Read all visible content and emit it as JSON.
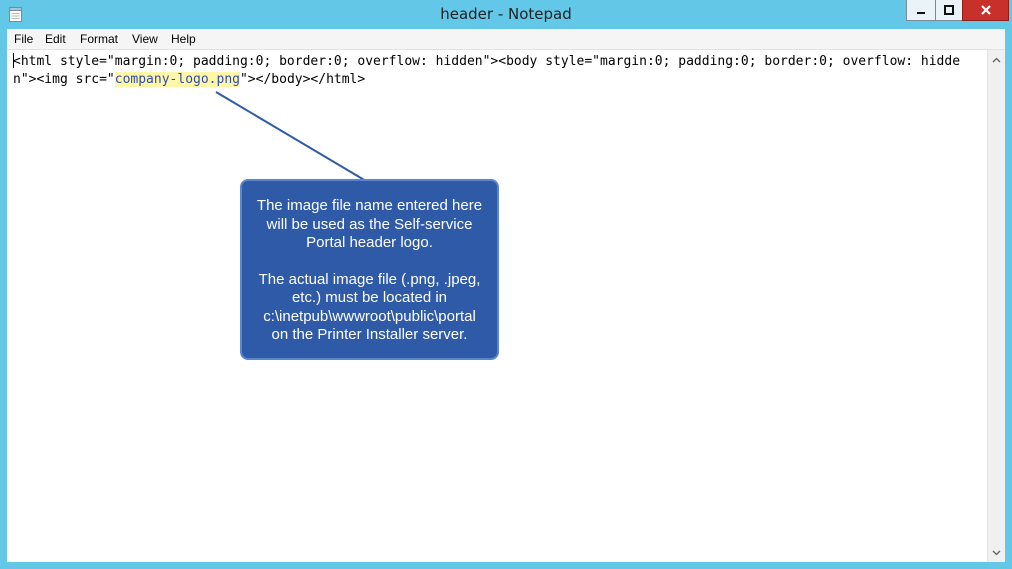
{
  "window": {
    "title": "header - Notepad",
    "icon": "notepad-icon",
    "controls": [
      "minimize-icon",
      "maximize-icon",
      "close-icon"
    ]
  },
  "menu": {
    "items": [
      {
        "label": "File"
      },
      {
        "label": "Edit"
      },
      {
        "label": "Format"
      },
      {
        "label": "View"
      },
      {
        "label": "Help"
      }
    ]
  },
  "editor": {
    "text_before": "html style=\"margin:0; padding:0; border:0; overflow: hidden\"><body style=\"margin:0; padding:0; border:0; overflow: hidden\"><img src=\"",
    "lead_char": "<",
    "highlighted": "company-logo.png",
    "text_after": "\"></body></html>"
  },
  "callout": {
    "paragraph1": "The image file name entered here will be used as the Self-service Portal header logo.",
    "paragraph2": "The actual image file (.png, .jpeg, etc.) must be located in c:\\inetpub\\wwwroot\\public\\portal on the Printer Installer server."
  },
  "colors": {
    "desktop": "#63c7e8",
    "callout": "#2e5aa8",
    "highlight": "#fff7a8",
    "close_button": "#c7302b"
  }
}
